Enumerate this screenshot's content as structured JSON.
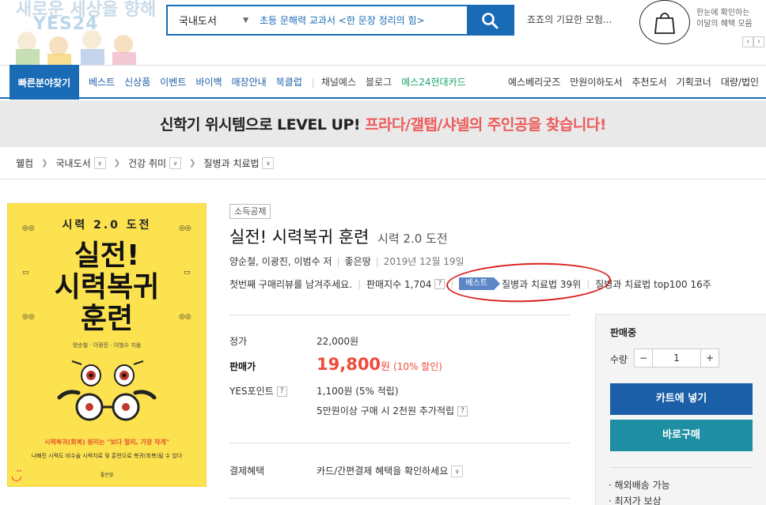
{
  "header": {
    "logo_text": "YES24",
    "logo_script": "새로운 세상을 향해",
    "search_category": "국내도서",
    "search_placeholder": "초등 문해력 교과서 <한 문장 정리의 힘>",
    "suggestion": "죠죠의 기묘한 모험...",
    "promo_line1": "한눈에 확인하는",
    "promo_line2": "이달의 혜택 모음",
    "pager_prev": "‹",
    "pager_next": "›"
  },
  "gnb": {
    "quick": "빠른분야찾기",
    "left_items": [
      "베스트",
      "신상품",
      "이벤트",
      "바이백",
      "매장안내",
      "북클럽"
    ],
    "mid_items": [
      "채널예스",
      "블로그"
    ],
    "green_item": "예스24현대카드",
    "right_items": [
      "예스베리굿즈",
      "만원이하도서",
      "추천도서",
      "기획코너",
      "대량/법인"
    ]
  },
  "banner": {
    "part1": "신학기 위시템으로 LEVEL UP!",
    "part2": "프라다/갤탭/샤넬의 주인공을 찾습니다!"
  },
  "breadcrumb": [
    "웰컴",
    "국내도서",
    "건강 취미",
    "질병과 치료법"
  ],
  "book": {
    "cover_series": "시력 2.0 도전",
    "cover_title_line1": "실전!",
    "cover_title_line2": "시력복귀",
    "cover_title_line3": "훈련",
    "cover_authors": "양순철 · 이광진 · 이범수 지음",
    "cover_tagline": "시력복귀(회복) 원리는 \"보다 멀리, 가장 작게\"",
    "cover_desc": "나빠진 시력도 비수술 시력치료 및 훈련으로 복귀(회복)될 수 있다",
    "cover_publisher": "좋은땅",
    "badge": "소득공제",
    "title": "실전! 시력복귀 훈련",
    "subtitle": "시력 2.0 도전",
    "authors": "양순철, 이광진, 이범수 저",
    "publisher": "좋은땅",
    "date": "2019년 12월 19일",
    "review_prompt": "첫번째 구매리뷰를 남겨주세요.",
    "sales_index": "판매지수 1,704",
    "best_badge": "베스트",
    "rank1": "질병과 치료법 39위",
    "rank2": "질병과 치료법 top100 16주"
  },
  "price": {
    "list_label": "정가",
    "list_value": "22,000원",
    "sale_label": "판매가",
    "sale_value": "19,800",
    "sale_unit": "원",
    "discount": "(10% 할인)",
    "points_label": "YES포인트",
    "points_value": "1,100원 (5% 적립)",
    "extra_points": "5만원이상 구매 시 2천원 추가적립",
    "payment_label": "결제혜택",
    "payment_value": "카드/간편결제 혜택을 확인하세요"
  },
  "panel": {
    "status": "판매중",
    "qty_label": "수량",
    "qty_value": "1",
    "minus": "−",
    "plus": "+",
    "cart": "카트에 넣기",
    "buy": "바로구매",
    "info1": "· 해외배송 가능",
    "info2": "· 최저가 보상"
  },
  "colors": {
    "brand_blue": "#1a6bb5",
    "sale_red": "#ef4a3a",
    "cover_yellow": "#fde24f",
    "buy_teal": "#1e8fa3"
  }
}
